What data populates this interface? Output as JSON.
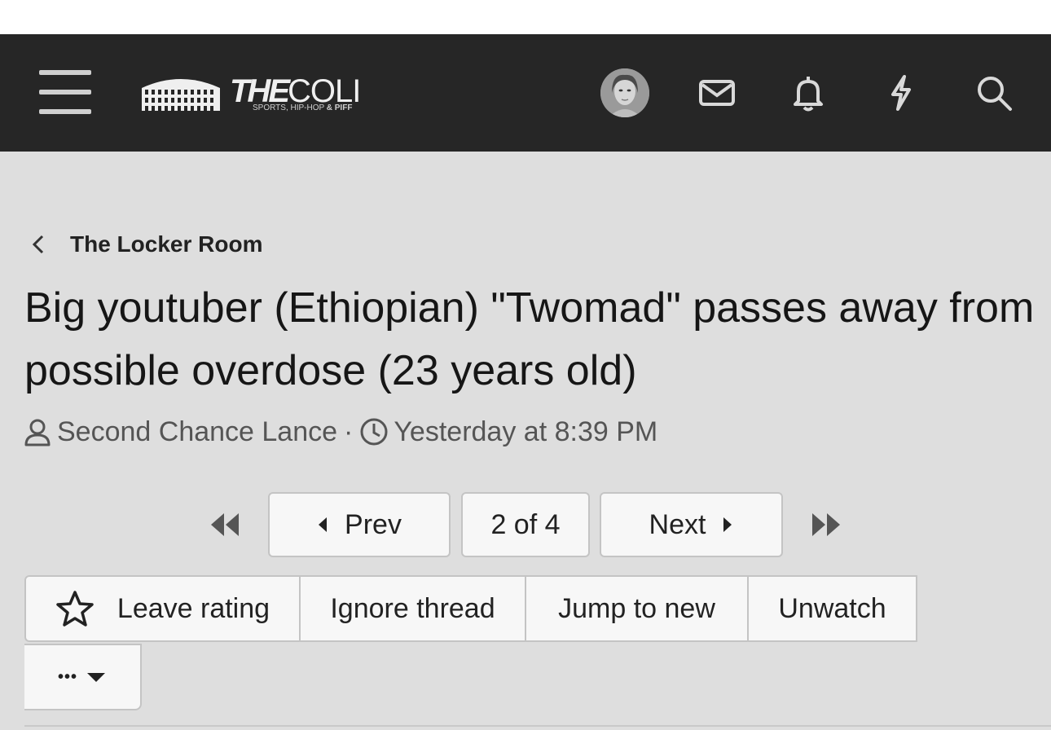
{
  "header": {
    "logo": {
      "word_bold": "THE",
      "word_light": "COLI",
      "tagline": "SPORTS, HIP-HOP",
      "tagline_bold": "& PIFF"
    },
    "icons": [
      "menu-icon",
      "avatar",
      "mail-icon",
      "bell-icon",
      "bolt-icon",
      "search-icon"
    ]
  },
  "breadcrumb": {
    "label": "The Locker Room"
  },
  "thread": {
    "title": "Big youtuber (Ethiopian) \"Twomad\" passes away from possible overdose (23 years old)",
    "author": "Second Chance Lance",
    "separator": "·",
    "time": "Yesterday at 8:39 PM"
  },
  "pagination": {
    "prev_label": "Prev",
    "page_label": "2 of 4",
    "next_label": "Next",
    "current_page": 2,
    "total_pages": 4
  },
  "actions": {
    "leave_rating": "Leave rating",
    "ignore_thread": "Ignore thread",
    "jump_to_new": "Jump to new",
    "unwatch": "Unwatch",
    "more": "•••"
  },
  "colors": {
    "header_bg": "#262626",
    "page_bg": "#dedede",
    "button_bg": "#f7f7f7"
  }
}
